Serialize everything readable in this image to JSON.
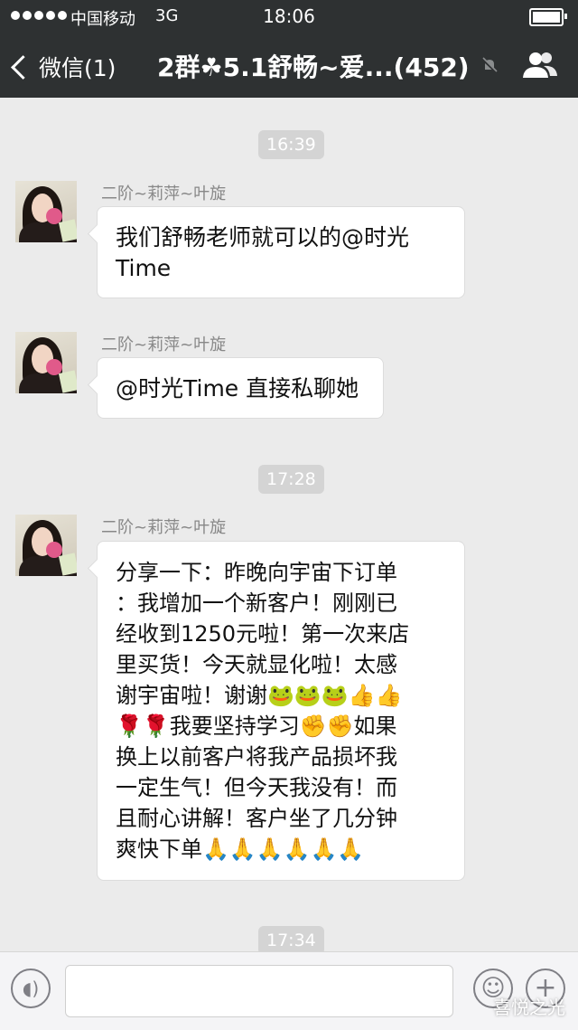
{
  "status_bar": {
    "carrier": "中国移动",
    "network": "3G",
    "time": "18:06"
  },
  "nav": {
    "back_label": "微信(1)",
    "title": "2群☘5.1舒畅~爱...(452)"
  },
  "timestamps": [
    "16:39",
    "17:28",
    "17:34"
  ],
  "messages": [
    {
      "sender": "二阶~莉萍~叶旋",
      "text": "我们舒畅老师就可以的@时光\nTime"
    },
    {
      "sender": "二阶~莉萍~叶旋",
      "text": "@时光Time 直接私聊她"
    },
    {
      "sender": "二阶~莉萍~叶旋",
      "text": "分享一下：昨晚向宇宙下订单\n：我增加一个新客户！刚刚已\n经收到1250元啦！第一次来店\n里买货！今天就显化啦！太感\n谢宇宙啦！谢谢🐸🐸🐸👍👍\n🌹🌹我要坚持学习✊✊如果\n换上以前客户将我产品损坏我\n一定生气！但今天我没有！而\n且耐心讲解！客户坐了几分钟\n爽快下单🙏🙏🙏🙏🙏🙏"
    }
  ],
  "input": {
    "placeholder": ""
  },
  "watermark": "喜悦之光",
  "colors": {
    "nav_bg": "#2e3132",
    "chat_bg": "#ebebeb",
    "bubble_bg": "#ffffff",
    "timestamp_bg": "#d4d4d4"
  },
  "icons": {
    "back": "chevron-left-icon",
    "mute": "mute-bell-icon",
    "members": "group-members-icon",
    "voice": "voice-icon",
    "emoji": "emoji-icon",
    "plus": "plus-icon"
  }
}
